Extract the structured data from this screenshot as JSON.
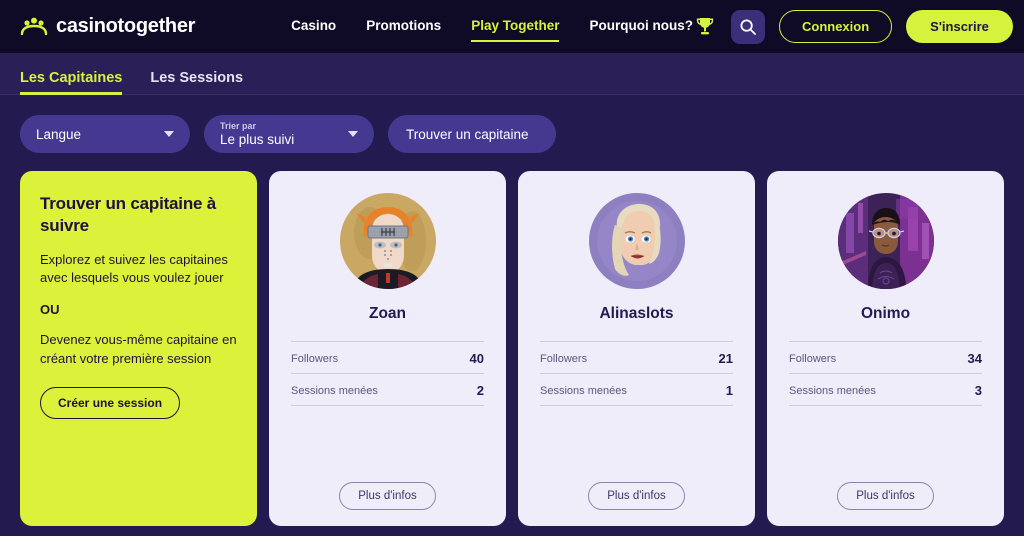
{
  "brand": {
    "name": "casinotogether",
    "logo_icon": "people-group-icon"
  },
  "nav": {
    "items": [
      {
        "label": "Casino",
        "active": false
      },
      {
        "label": "Promotions",
        "active": false
      },
      {
        "label": "Play Together",
        "active": true
      },
      {
        "label": "Pourquoi nous?",
        "active": false
      }
    ],
    "trophy_icon": "trophy-icon",
    "search_icon": "search-icon",
    "login_label": "Connexion",
    "signup_label": "S'inscrire"
  },
  "tabs": [
    {
      "label": "Les Capitaines",
      "active": true
    },
    {
      "label": "Les Sessions",
      "active": false
    }
  ],
  "filters": {
    "language": {
      "label": "Langue",
      "caret_icon": "chevron-down-icon"
    },
    "sort": {
      "mini_label": "Trier par",
      "value": "Le plus suivi",
      "caret_icon": "chevron-down-icon"
    },
    "search": {
      "placeholder": "Trouver un capitaine",
      "value": "Trouver un capitaine"
    }
  },
  "promo": {
    "title": "Trouver un capitaine à suivre",
    "paragraph1": "Explorez et suivez les capitaines avec lesquels vous voulez jouer",
    "or": "OU",
    "paragraph2": "Devenez vous-même capitaine en créant votre première session",
    "button_label": "Créer une session"
  },
  "captains": [
    {
      "name": "Zoan",
      "avatar_icon": "avatar-zoan",
      "followers_label": "Followers",
      "followers_value": "40",
      "sessions_label": "Sessions menées",
      "sessions_value": "2",
      "more_label": "Plus d'infos"
    },
    {
      "name": "Alinaslots",
      "avatar_icon": "avatar-alinaslots",
      "followers_label": "Followers",
      "followers_value": "21",
      "sessions_label": "Sessions menées",
      "sessions_value": "1",
      "more_label": "Plus d'infos"
    },
    {
      "name": "Onimo",
      "avatar_icon": "avatar-onimo",
      "followers_label": "Followers",
      "followers_value": "34",
      "sessions_label": "Sessions menées",
      "sessions_value": "3",
      "more_label": "Plus d'infos"
    }
  ],
  "colors": {
    "accent_lime": "#d7f23c",
    "header_bg": "#0f0a26",
    "page_bg": "#231b4f",
    "tabs_bg": "#2a2057",
    "pill_bg": "#453891",
    "card_bg": "#efedfa",
    "text_dark": "#241a52"
  }
}
